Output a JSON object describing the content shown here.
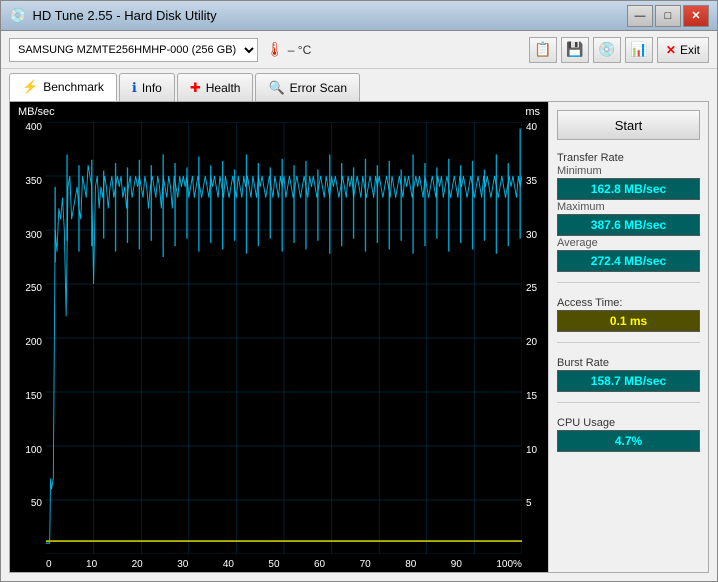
{
  "window": {
    "title": "HD Tune 2.55 - Hard Disk Utility",
    "title_icon": "💿",
    "min_btn": "—",
    "max_btn": "□",
    "close_btn": "✕"
  },
  "toolbar": {
    "drive_select_value": "SAMSUNG MZMTE256HMHP-000 (256 GB)",
    "temp_label": "– °C",
    "exit_label": "Exit"
  },
  "tabs": [
    {
      "id": "benchmark",
      "label": "Benchmark",
      "icon": "⚡",
      "active": true
    },
    {
      "id": "info",
      "label": "Info",
      "icon": "ℹ",
      "active": false
    },
    {
      "id": "health",
      "label": "Health",
      "icon": "✚",
      "active": false
    },
    {
      "id": "errorscan",
      "label": "Error Scan",
      "icon": "🔍",
      "active": false
    }
  ],
  "chart": {
    "y_axis_left_label": "MB/sec",
    "y_axis_right_label": "ms",
    "y_left_values": [
      "400",
      "350",
      "300",
      "250",
      "200",
      "150",
      "100",
      "50",
      ""
    ],
    "y_right_values": [
      "40",
      "35",
      "30",
      "25",
      "20",
      "15",
      "10",
      "5",
      ""
    ],
    "x_values": [
      "0",
      "10",
      "20",
      "30",
      "40",
      "50",
      "60",
      "70",
      "80",
      "90",
      "100%"
    ]
  },
  "stats": {
    "start_label": "Start",
    "transfer_rate_label": "Transfer Rate",
    "minimum_label": "Minimum",
    "minimum_value": "162.8 MB/sec",
    "maximum_label": "Maximum",
    "maximum_value": "387.6 MB/sec",
    "average_label": "Average",
    "average_value": "272.4 MB/sec",
    "access_time_label": "Access Time:",
    "access_time_value": "0.1 ms",
    "burst_rate_label": "Burst Rate",
    "burst_rate_value": "158.7 MB/sec",
    "cpu_usage_label": "CPU Usage",
    "cpu_usage_value": "4.7%"
  },
  "colors": {
    "accent_cyan": "#00ffff",
    "accent_yellow": "#ffff00",
    "chart_bg": "#000000",
    "chart_line": "#00ccff",
    "chart_grid": "#004466",
    "chart_yellow": "#cccc00"
  }
}
